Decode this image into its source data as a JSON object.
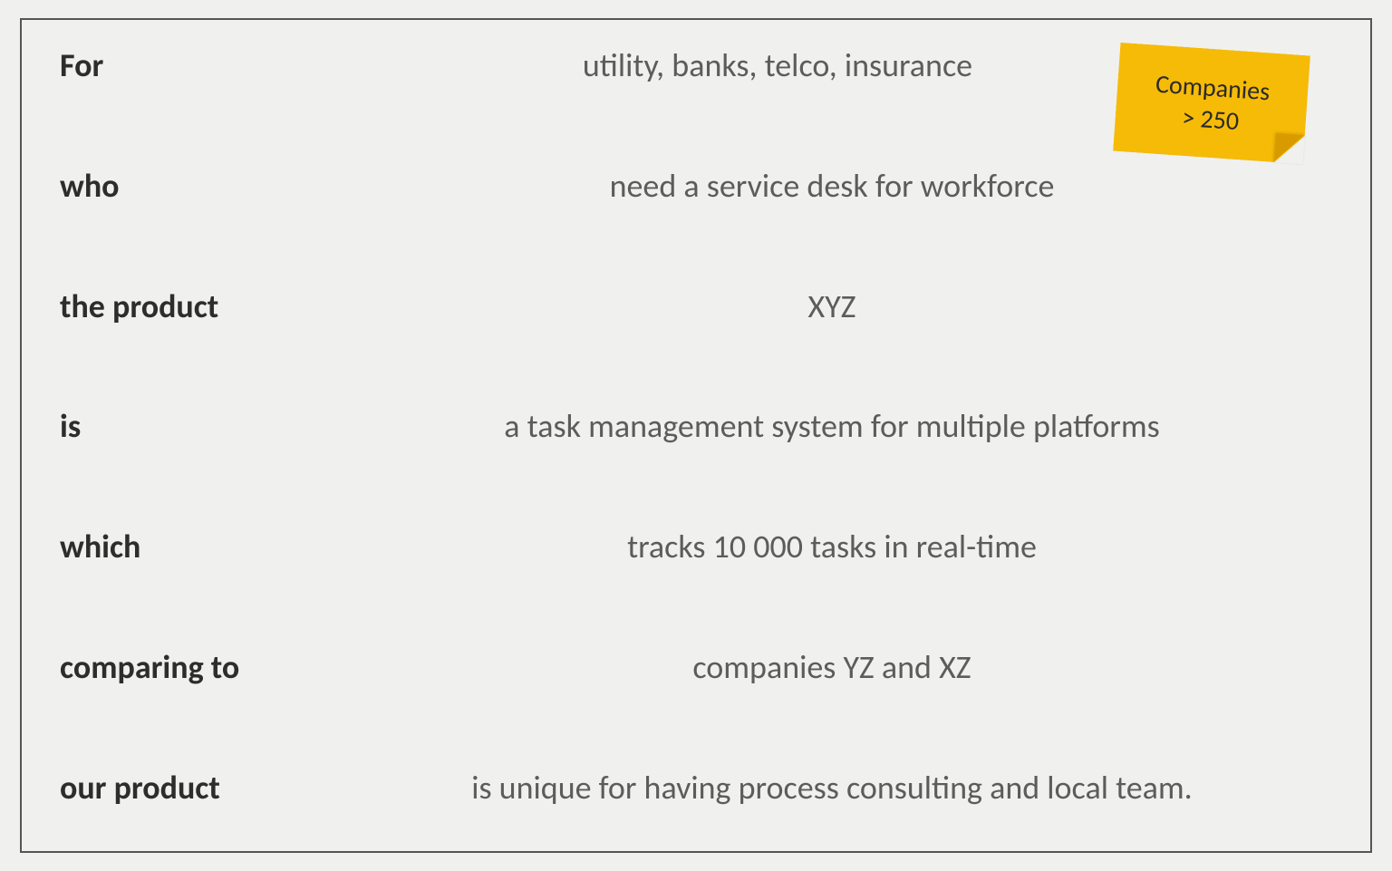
{
  "rows": [
    {
      "label": "For",
      "value": "utility, banks, telco, insurance"
    },
    {
      "label": "who",
      "value": "need a service desk for workforce"
    },
    {
      "label": "the product",
      "value": "XYZ"
    },
    {
      "label": "is",
      "value": "a task management system for multiple platforms"
    },
    {
      "label": "which",
      "value": "tracks 10 000 tasks in real-time"
    },
    {
      "label": "comparing to",
      "value": "companies YZ and XZ"
    },
    {
      "label": "our product",
      "value": "is unique for having process consulting and local team."
    }
  ],
  "sticky_note": {
    "line1": "Companies",
    "line2": "> 250"
  }
}
